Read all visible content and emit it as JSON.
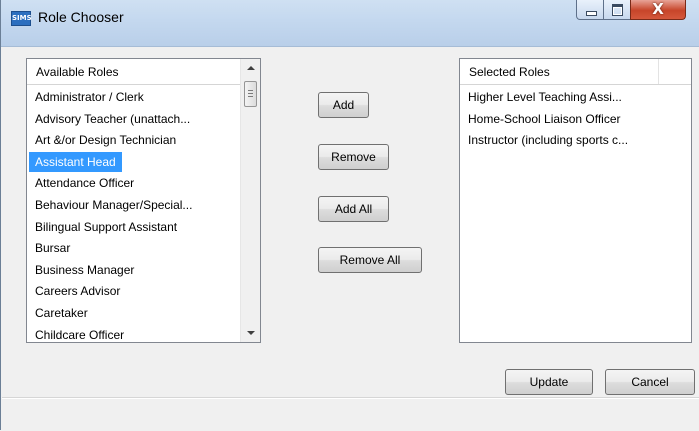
{
  "window": {
    "title": "Role Chooser",
    "app_icon_text": "SIMS",
    "controls": [
      "minimize-icon",
      "maximize-icon",
      "close-icon"
    ],
    "close_glyph": "X"
  },
  "available": {
    "header": "Available Roles",
    "items": [
      "Administrator / Clerk",
      "Advisory Teacher (unattach...",
      "Art &/or Design Technician",
      "Assistant Head",
      "Attendance Officer",
      "Behaviour Manager/Special...",
      "Bilingual Support Assistant",
      "Bursar",
      "Business Manager",
      "Careers Advisor",
      "Caretaker",
      "Childcare Officer"
    ],
    "selected_index": 3
  },
  "selected": {
    "header": "Selected Roles",
    "items": [
      "Higher Level Teaching Assi...",
      "Home-School Liaison Officer",
      "Instructor (including sports c..."
    ]
  },
  "buttons": {
    "add": "Add",
    "remove": "Remove",
    "add_all": "Add All",
    "remove_all": "Remove All",
    "update": "Update",
    "cancel": "Cancel"
  },
  "colors": {
    "selection": "#3399ff",
    "close_button": "#c7452a"
  }
}
